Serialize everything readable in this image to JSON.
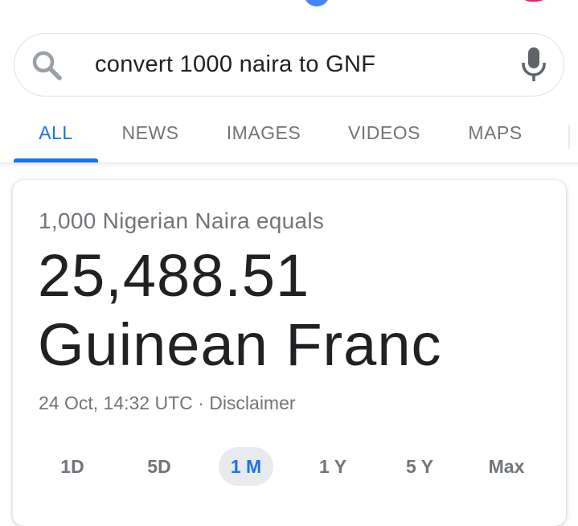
{
  "search": {
    "query": "convert 1000 naira to GNF"
  },
  "tabs": [
    {
      "label": "ALL",
      "active": true
    },
    {
      "label": "NEWS",
      "active": false
    },
    {
      "label": "IMAGES",
      "active": false
    },
    {
      "label": "VIDEOS",
      "active": false
    },
    {
      "label": "MAPS",
      "active": false
    }
  ],
  "converter": {
    "from_text": "1,000 Nigerian Naira equals",
    "result_text": "25,488.51 Guinean Franc",
    "timestamp": "24 Oct, 14:32 UTC",
    "separator": "·",
    "disclaimer": "Disclaimer"
  },
  "ranges": [
    {
      "label": "1D",
      "selected": false
    },
    {
      "label": "5D",
      "selected": false
    },
    {
      "label": "1 M",
      "selected": true
    },
    {
      "label": "1 Y",
      "selected": false
    },
    {
      "label": "5 Y",
      "selected": false
    },
    {
      "label": "Max",
      "selected": false
    }
  ],
  "colors": {
    "accent": "#1a73e8",
    "muted_text": "#70757a",
    "main_text": "#202124"
  },
  "icons": {
    "search": "search-icon",
    "mic": "microphone-icon"
  }
}
